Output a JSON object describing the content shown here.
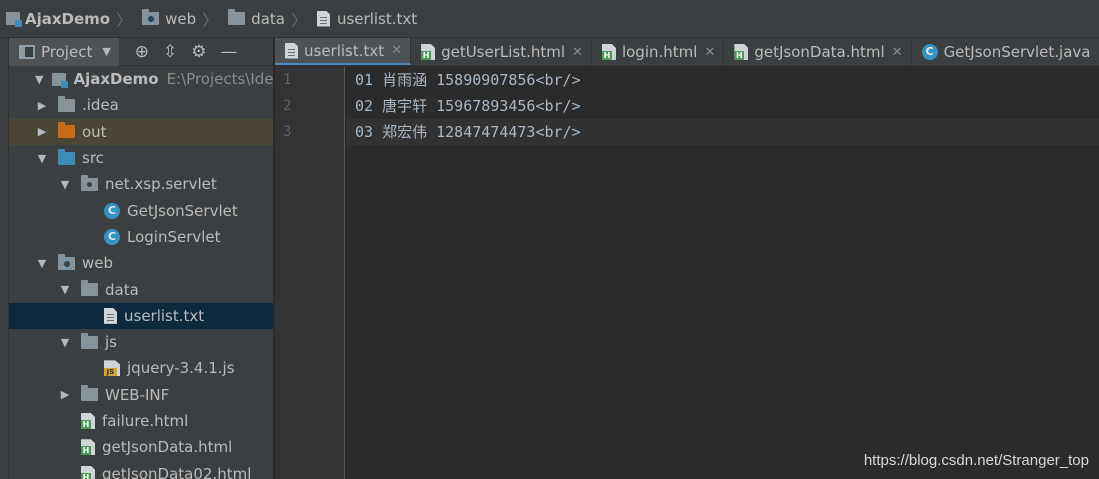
{
  "breadcrumb": {
    "project": "AjaxDemo",
    "folder1": "web",
    "folder2": "data",
    "file": "userlist.txt"
  },
  "project_panel": {
    "view_selector": "Project",
    "tree": [
      {
        "name": "AjaxDemo",
        "path": "E:\\Projects\\IdeaPr"
      },
      {
        "name": ".idea"
      },
      {
        "name": "out"
      },
      {
        "name": "src"
      },
      {
        "name": "net.xsp.servlet"
      },
      {
        "name": "GetJsonServlet"
      },
      {
        "name": "LoginServlet"
      },
      {
        "name": "web"
      },
      {
        "name": "data"
      },
      {
        "name": "userlist.txt"
      },
      {
        "name": "js"
      },
      {
        "name": "jquery-3.4.1.js"
      },
      {
        "name": "WEB-INF"
      },
      {
        "name": "failure.html"
      },
      {
        "name": "getJsonData.html"
      },
      {
        "name": "getJsonData02.html"
      }
    ]
  },
  "tabs": [
    {
      "label": "userlist.txt",
      "icon": "text-file-icon",
      "active": true
    },
    {
      "label": "getUserList.html",
      "icon": "html-file-icon"
    },
    {
      "label": "login.html",
      "icon": "html-file-icon"
    },
    {
      "label": "getJsonData.html",
      "icon": "html-file-icon"
    },
    {
      "label": "GetJsonServlet.java",
      "icon": "java-class-icon"
    }
  ],
  "editor": {
    "line_numbers": [
      "1",
      "2",
      "3"
    ],
    "lines": [
      "01 肖雨涵 15890907856<br/>",
      "02 唐宇轩 15967893456<br/>",
      "03 郑宏伟 12847474473<br/>"
    ],
    "current_line": 3
  },
  "watermark": "https://blog.csdn.net/Stranger_top",
  "colors": {
    "panel_bg": "#3c3f41",
    "editor_bg": "#2b2b2b",
    "selection": "#0d293e",
    "excluded_folder": "#c56b1a",
    "active_tab_underline": "#4a88c7"
  }
}
